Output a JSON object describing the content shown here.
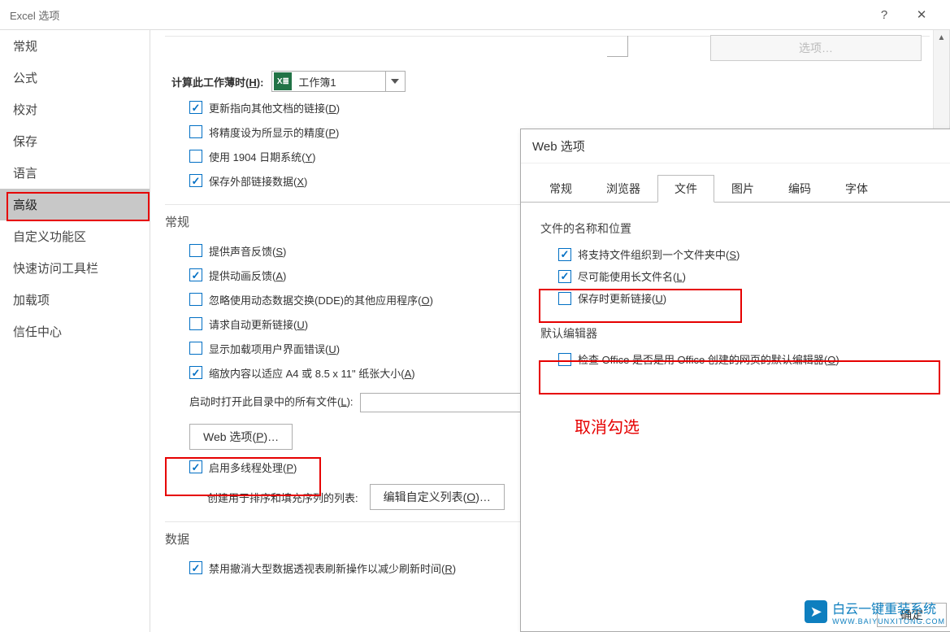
{
  "dialog": {
    "title": "Excel 选项"
  },
  "sidebar": {
    "items": [
      {
        "label": "常规"
      },
      {
        "label": "公式"
      },
      {
        "label": "校对"
      },
      {
        "label": "保存"
      },
      {
        "label": "语言"
      },
      {
        "label": "高级",
        "selected": true
      },
      {
        "label": "自定义功能区"
      },
      {
        "label": "快速访问工具栏"
      },
      {
        "label": "加载项"
      },
      {
        "label": "信任中心"
      }
    ]
  },
  "top_button_ghost": "选项…",
  "calc": {
    "label_pre": "计算此工作薄时",
    "label_key": "H",
    "workbook": "工作簿1",
    "items": [
      {
        "txt": "更新指向其他文档的链接",
        "key": "D",
        "checked": true
      },
      {
        "txt": "将精度设为所显示的精度",
        "key": "P",
        "checked": false
      },
      {
        "txt": "使用 1904 日期系统",
        "key": "Y",
        "checked": false
      },
      {
        "txt": "保存外部链接数据",
        "key": "X",
        "checked": true
      }
    ]
  },
  "general": {
    "heading": "常规",
    "items": [
      {
        "txt": "提供声音反馈",
        "key": "S",
        "checked": false
      },
      {
        "txt": "提供动画反馈",
        "key": "A",
        "checked": true
      },
      {
        "txt": "忽略使用动态数据交换(DDE)的其他应用程序",
        "key": "O",
        "checked": false
      },
      {
        "txt": "请求自动更新链接",
        "key": "U",
        "checked": false
      },
      {
        "txt": "显示加载项用户界面错误",
        "key": "U",
        "checked": false
      },
      {
        "txt": "缩放内容以适应 A4 或 8.5 x 11\" 纸张大小",
        "key": "A",
        "checked": true
      }
    ],
    "startup_label_pre": "启动时打开此目录中的所有文件",
    "startup_key": "L",
    "web_btn_pre": "Web 选项",
    "web_btn_key": "P",
    "web_btn_suf": "…",
    "multithread_txt": "启用多线程处理",
    "multithread_key": "P",
    "multithread_checked": true,
    "sortlist_label": "创建用于排序和填充序列的列表:",
    "sortlist_btn_pre": "编辑自定义列表",
    "sortlist_btn_key": "O",
    "sortlist_btn_suf": "…"
  },
  "data": {
    "heading": "数据",
    "items": [
      {
        "txt": "禁用撤消大型数据透视表刷新操作以减少刷新时间",
        "key": "R",
        "checked": true
      }
    ]
  },
  "subdialog": {
    "title": "Web 选项",
    "tabs": [
      "常规",
      "浏览器",
      "文件",
      "图片",
      "编码",
      "字体"
    ],
    "selected_tab": "文件",
    "group1": "文件的名称和位置",
    "g1_items": [
      {
        "txt": "将支持文件组织到一个文件夹中",
        "key": "S",
        "checked": true
      },
      {
        "txt": "尽可能使用长文件名",
        "key": "L",
        "checked": true
      },
      {
        "txt": "保存时更新链接",
        "key": "U",
        "checked": false
      }
    ],
    "group2": "默认编辑器",
    "g2_items": [
      {
        "txt": "检查 Office 是否是用 Office 创建的网页的默认编辑器",
        "key": "O",
        "checked": false
      }
    ],
    "ok_btn": "确定",
    "annotation": "取消勾选"
  },
  "watermark": {
    "text": "白云一键重装系统",
    "sub": "WWW.BAIYUNXITONG.COM"
  }
}
